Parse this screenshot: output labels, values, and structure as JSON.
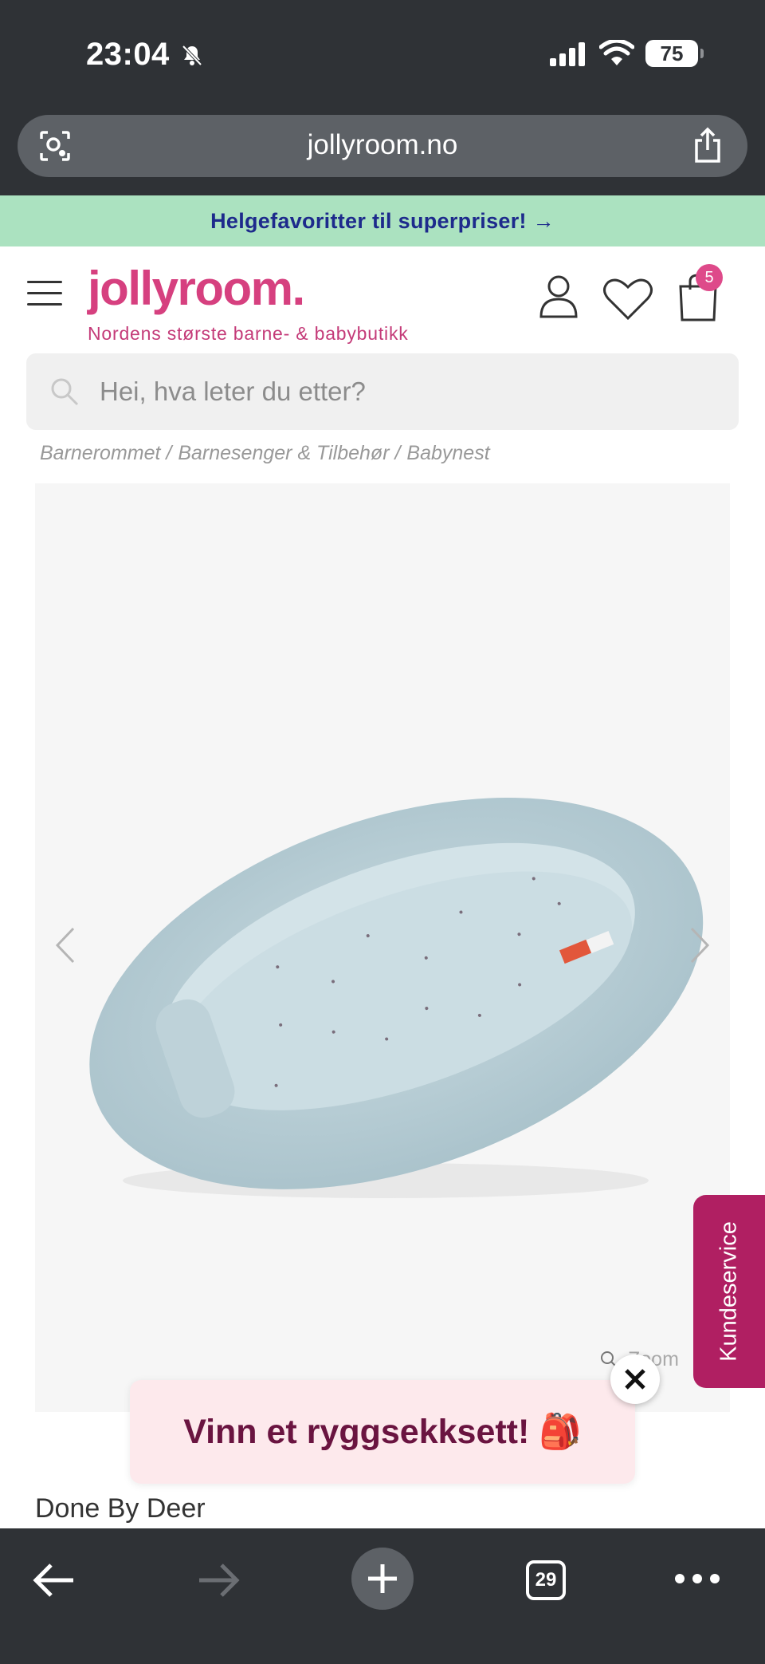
{
  "status_bar": {
    "time": "23:04",
    "battery": "75"
  },
  "browser": {
    "url": "jollyroom.no",
    "tab_count": "29"
  },
  "promo": {
    "text": "Helgefavoritter til superpriser! →"
  },
  "header": {
    "logo": "jollyroom.",
    "tagline": "Nordens største barne- & babybutikk",
    "cart_count": "5"
  },
  "search": {
    "placeholder": "Hei, hva leter du etter?"
  },
  "breadcrumb": [
    "Barnerommet /",
    "Barnesenger & Tilbehør /",
    "Babynest"
  ],
  "product": {
    "zoom_label": "Zoom",
    "brand": "Done By Deer"
  },
  "side_tab": {
    "label": "Kundeservice"
  },
  "popup": {
    "text": "Vinn et ryggsekksett! 🎒"
  },
  "colors": {
    "brand_pink": "#d6407f",
    "promo_bg": "#abe2c0",
    "promo_text": "#1d2a8c",
    "kundeservice_bg": "#b01f62",
    "chrome_bg": "#2f3236"
  }
}
